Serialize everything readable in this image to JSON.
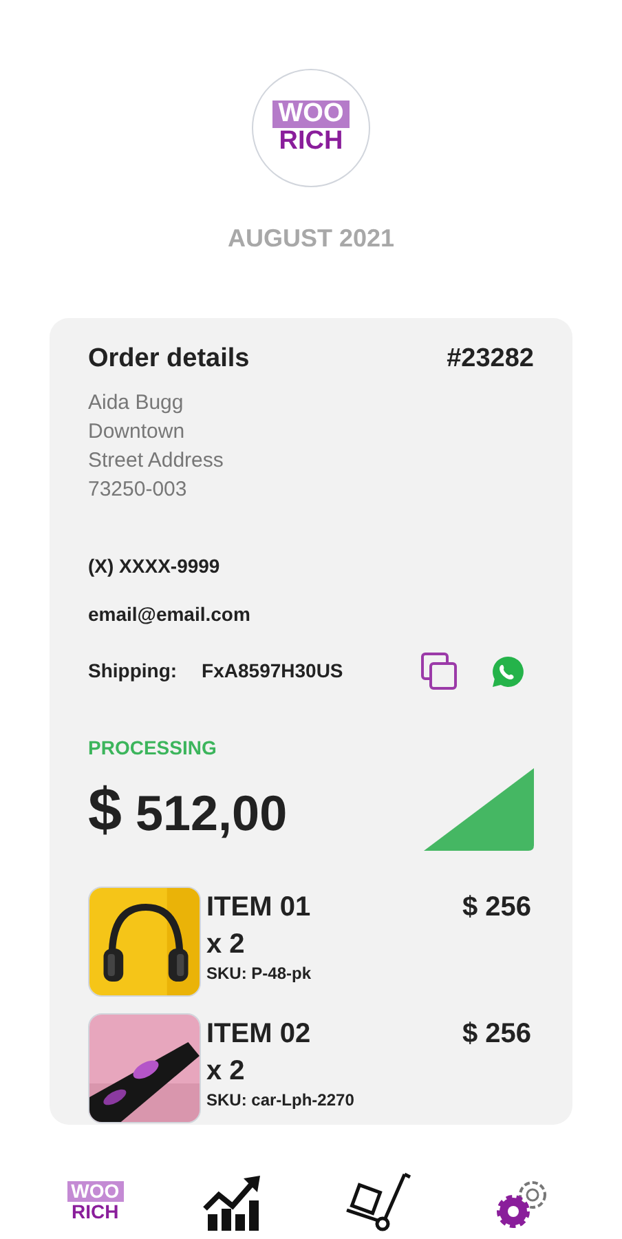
{
  "logo": {
    "top": "WOO",
    "bottom": "RICH"
  },
  "period": "AUGUST 2021",
  "order": {
    "title": "Order details",
    "number": "#23282",
    "address": [
      "Aida Bugg",
      "Downtown",
      "Street Address",
      "73250-003"
    ],
    "phone": "(X) XXXX-9999",
    "email": "email@email.com",
    "shipping_label": "Shipping:",
    "shipping_code": "FxA8597H30US",
    "status": "PROCESSING",
    "currency": "$",
    "total": "512,00",
    "items": [
      {
        "kind": "headphones",
        "name": "ITEM 01",
        "quantity": "x 2",
        "sku": "SKU: P-48-pk",
        "price": "$ 256"
      },
      {
        "kind": "sunglasses",
        "name": "ITEM 02",
        "quantity": "x 2",
        "sku": "SKU: car-Lph-2270",
        "price": "$ 256"
      }
    ]
  },
  "nav": [
    {
      "kind": "logo",
      "top": "WOO",
      "bottom": "RICH"
    },
    {
      "kind": "chart"
    },
    {
      "kind": "delivery"
    },
    {
      "kind": "settings"
    }
  ]
}
